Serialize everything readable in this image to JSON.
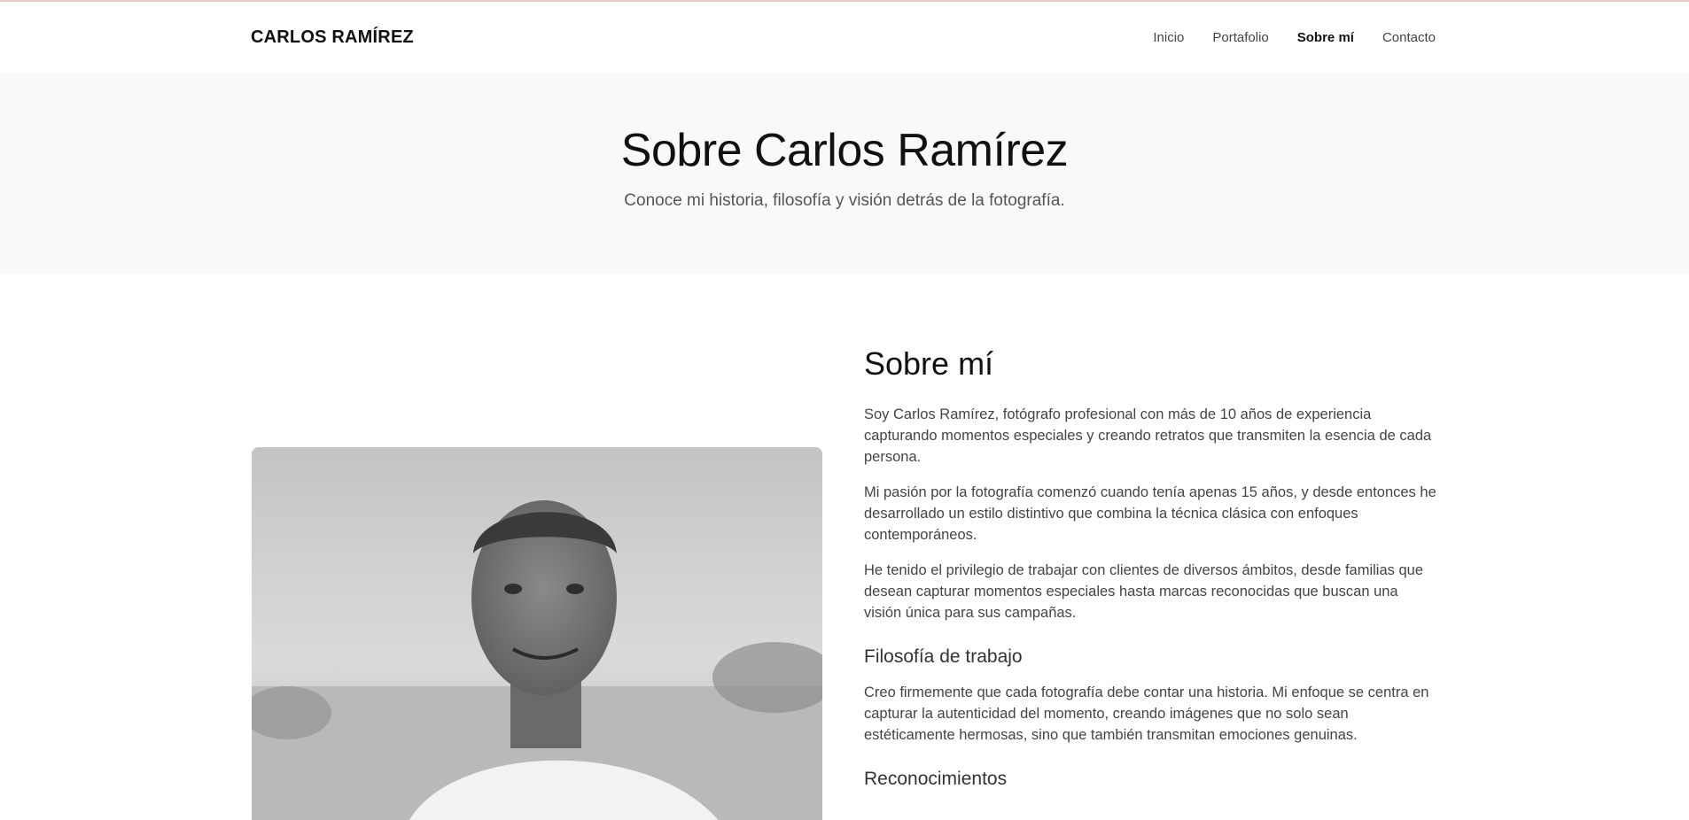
{
  "brand": "CARLOS RAMÍREZ",
  "nav": {
    "items": [
      {
        "label": "Inicio"
      },
      {
        "label": "Portafolio"
      },
      {
        "label": "Sobre mí"
      },
      {
        "label": "Contacto"
      }
    ],
    "active": "Sobre mí"
  },
  "hero": {
    "title": "Sobre Carlos Ramírez",
    "subtitle": "Conoce mi historia, filosofía y visión detrás de la fotografía."
  },
  "about": {
    "heading": "Sobre mí",
    "paragraphs": [
      "Soy Carlos Ramírez, fotógrafo profesional con más de 10 años de experiencia capturando momentos especiales y creando retratos que transmiten la esencia de cada persona.",
      "Mi pasión por la fotografía comenzó cuando tenía apenas 15 años, y desde entonces he desarrollado un estilo distintivo que combina la técnica clásica con enfoques contemporáneos.",
      "He tenido el privilegio de trabajar con clientes de diversos ámbitos, desde familias que desean capturar momentos especiales hasta marcas reconocidas que buscan una visión única para sus campañas."
    ],
    "philosophy": {
      "heading": "Filosofía de trabajo",
      "text": "Creo firmemente que cada fotografía debe contar una historia. Mi enfoque se centra en capturar la autenticidad del momento, creando imágenes que no solo sean estéticamente hermosas, sino que también transmitan emociones genuinas."
    },
    "recognition": {
      "heading": "Reconocimientos"
    }
  },
  "colors": {
    "accent_line": "#e8c8bc",
    "hero_bg": "#f9f9f9"
  }
}
